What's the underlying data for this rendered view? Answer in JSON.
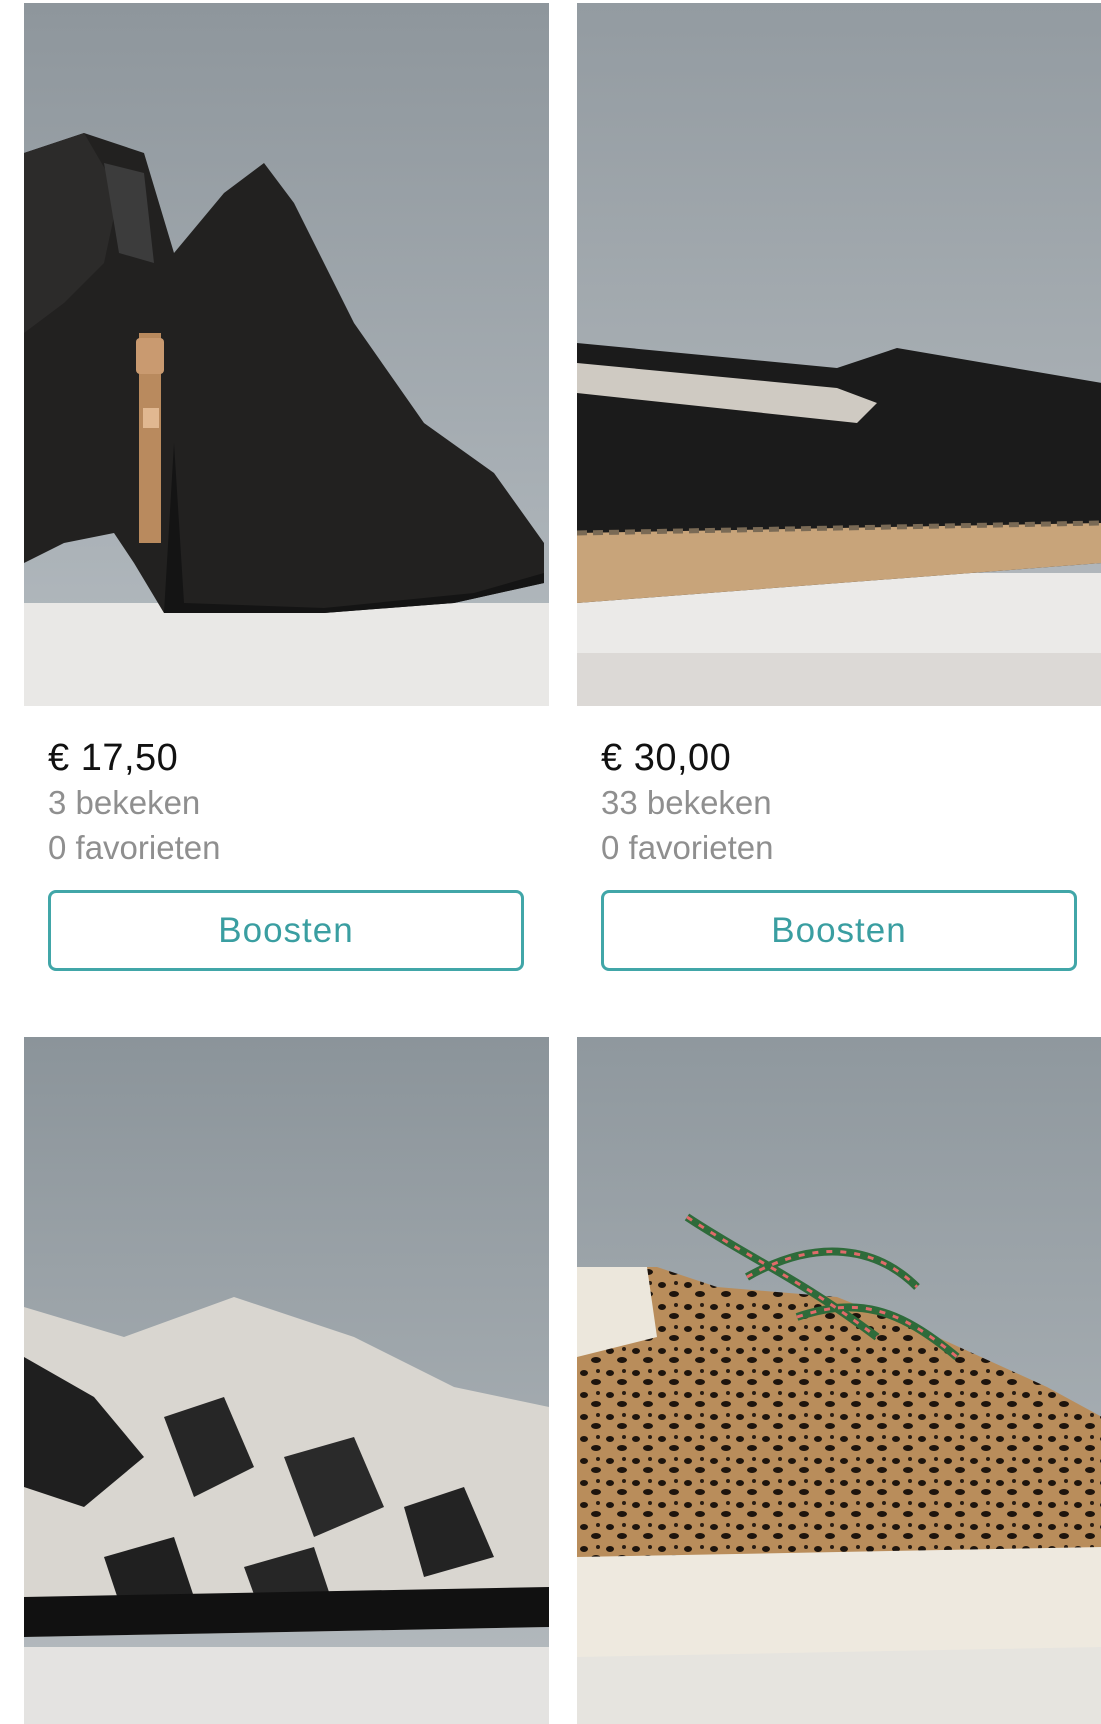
{
  "listings": [
    {
      "price": "€ 17,50",
      "views": "3 bekeken",
      "favorites": "0 favorieten",
      "action": "Boosten",
      "image_icon": "black-suede-ankle-boot-photo"
    },
    {
      "price": "€ 30,00",
      "views": "33 bekeken",
      "favorites": "0 favorieten",
      "action": "Boosten",
      "image_icon": "black-espadrille-photo"
    },
    {
      "image_icon": "snakeskin-loafer-photo"
    },
    {
      "image_icon": "leopard-print-sneaker-photo"
    }
  ],
  "colors": {
    "accent": "#41a6a8",
    "muted_text": "#8f8f8f",
    "price_text": "#111111"
  }
}
